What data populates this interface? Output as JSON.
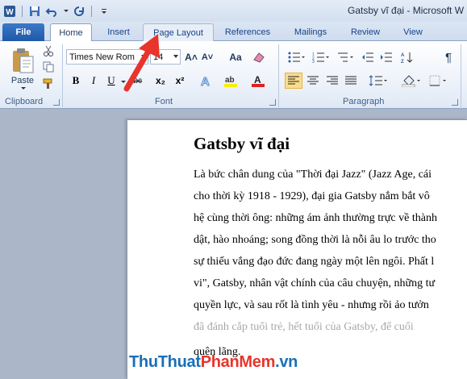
{
  "window": {
    "title": "Gatsby vĩ đại  -  Microsoft W"
  },
  "quick_access": {
    "icons": [
      "word-logo-icon",
      "save-icon",
      "undo-icon",
      "redo-icon",
      "customize-icon"
    ]
  },
  "tabs": [
    {
      "label": "File"
    },
    {
      "label": "Home"
    },
    {
      "label": "Insert"
    },
    {
      "label": "Page Layout"
    },
    {
      "label": "References"
    },
    {
      "label": "Mailings"
    },
    {
      "label": "Review"
    },
    {
      "label": "View"
    }
  ],
  "ribbon": {
    "clipboard": {
      "paste_label": "Paste",
      "group_label": "Clipboard"
    },
    "font": {
      "font_name": "Times New Rom",
      "font_size": "14",
      "bold": "B",
      "italic": "I",
      "underline": "U",
      "strike": "abc",
      "subscript": "x₂",
      "superscript": "x²",
      "grow_font": "A˄",
      "shrink_font": "A˅",
      "change_case": "Aa",
      "group_label": "Font"
    },
    "paragraph": {
      "group_label": "Paragraph",
      "pilcrow": "¶"
    }
  },
  "document": {
    "title": "Gatsby vĩ đại",
    "lines": [
      "Là bức chân dung của \"Thời đại Jazz\" (Jazz Age, cái",
      "cho thời kỳ 1918 - 1929), đại gia Gatsby nắm bắt vô",
      "hệ cùng thời ông: những ám ảnh thường trực về thành",
      "dật, hào nhoáng; song đồng thời là nỗi âu lo trước tho",
      "sự thiếu vắng đạo đức đang ngày một lên ngôi. Phất l",
      "vi\", Gatsby, nhân vật chính của câu chuyện, những tư",
      "quyền lực, và sau rốt là  tình yêu - nhưng rồi ảo tưởn",
      "đã đánh cắp tuổi trẻ, hết tuổi của Gatsby, để cuối",
      "quên lãng."
    ]
  },
  "watermark": {
    "part1": "ThuThuat",
    "part2": "PhanMem",
    "part3": ".vn"
  },
  "colors": {
    "file_tab": "#2a63b3",
    "annotation_arrow": "#e8342b",
    "font_color_bar": "#e02020",
    "highlight_bar": "#f8f000"
  }
}
